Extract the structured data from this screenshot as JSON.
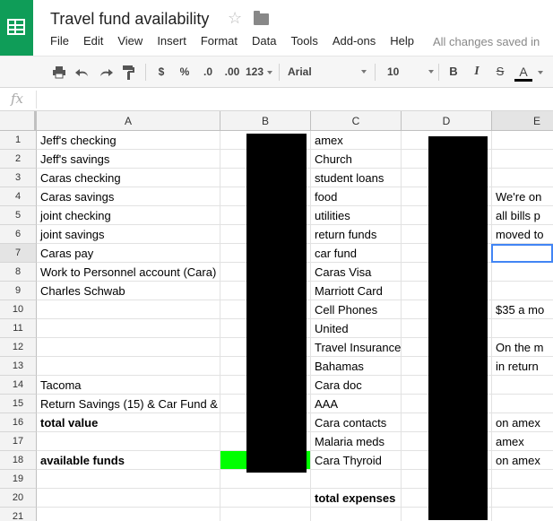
{
  "doc": {
    "title": "Travel fund availability",
    "save_status": "All changes saved in"
  },
  "menu": [
    "File",
    "Edit",
    "View",
    "Insert",
    "Format",
    "Data",
    "Tools",
    "Add-ons",
    "Help"
  ],
  "toolbar": {
    "currency": "$",
    "percent": "%",
    "dec_less": ".0",
    "dec_more": ".00",
    "more_formats": "123",
    "font": "Arial",
    "font_size": "10",
    "bold": "B",
    "italic": "I",
    "strike": "S",
    "text_color": "A"
  },
  "formula": {
    "fx": "fx",
    "value": ""
  },
  "columns": [
    "A",
    "B",
    "C",
    "D",
    "E"
  ],
  "rows": [
    {
      "n": "1",
      "a": "Jeff's checking",
      "c": "amex",
      "e": ""
    },
    {
      "n": "2",
      "a": "Jeff's savings",
      "c": "Church",
      "e": ""
    },
    {
      "n": "3",
      "a": "Caras checking",
      "c": "student loans",
      "e": ""
    },
    {
      "n": "4",
      "a": "Caras savings",
      "c": "food",
      "e": "We're on"
    },
    {
      "n": "5",
      "a": "joint checking",
      "c": "utilities",
      "e": "all bills p"
    },
    {
      "n": "6",
      "a": "joint savings",
      "c": "return funds",
      "e": "moved to"
    },
    {
      "n": "7",
      "a": "Caras pay",
      "c": "car fund",
      "e": ""
    },
    {
      "n": "8",
      "a": "Work to Personnel account (Cara)",
      "c": "Caras Visa",
      "e": ""
    },
    {
      "n": "9",
      "a": "Charles Schwab",
      "c": "Marriott Card",
      "e": ""
    },
    {
      "n": "10",
      "a": "",
      "c": "Cell Phones",
      "e": "$35 a mo"
    },
    {
      "n": "11",
      "a": "",
      "c": "United",
      "e": ""
    },
    {
      "n": "12",
      "a": "",
      "c": "Travel Insurance",
      "e": "On the m"
    },
    {
      "n": "13",
      "a": "",
      "c": "Bahamas",
      "e": "in return"
    },
    {
      "n": "14",
      "a": "Tacoma",
      "c": "Cara doc",
      "e": ""
    },
    {
      "n": "15",
      "a": "Return Savings (15) & Car Fund &",
      "c": "AAA",
      "e": ""
    },
    {
      "n": "16",
      "a": "total value",
      "c": "Cara contacts",
      "e": "on amex"
    },
    {
      "n": "17",
      "a": "",
      "c": "Malaria meds",
      "e": "amex"
    },
    {
      "n": "18",
      "a": "available funds",
      "c": "Cara Thyroid",
      "e": "on amex"
    },
    {
      "n": "19",
      "a": "",
      "c": "",
      "e": ""
    },
    {
      "n": "20",
      "a": "",
      "c": "total expenses",
      "e": ""
    },
    {
      "n": "21",
      "a": "",
      "c": "",
      "e": ""
    }
  ],
  "colors": {
    "brand_green": "#0f9d58",
    "highlight_green": "#00ff00",
    "selection_blue": "#4285f4"
  },
  "icons": [
    "sheets-logo-icon",
    "star-icon",
    "folder-icon",
    "print-icon",
    "undo-icon",
    "redo-icon",
    "paint-format-icon",
    "text-color-icon"
  ]
}
